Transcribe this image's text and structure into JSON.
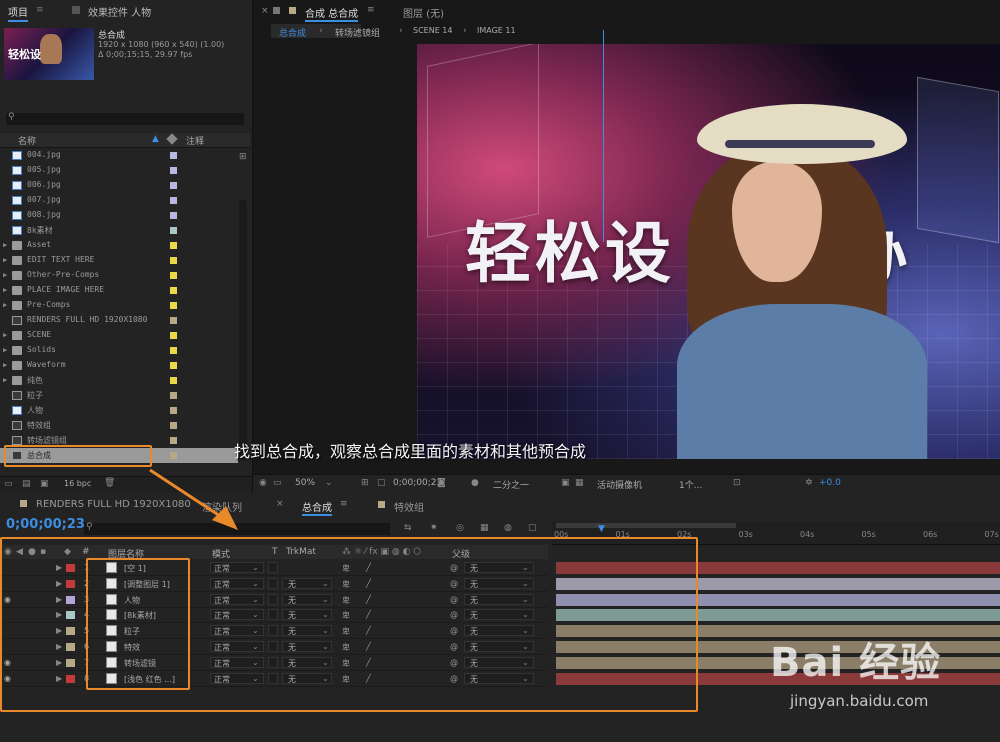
{
  "project_panel": {
    "tabs": [
      "项目",
      "效果控件 人物"
    ],
    "comp_info": {
      "name": "总合成",
      "line1": "1920 x 1080 (960 x 540) (1.00)",
      "line2": "Δ 0;00;15;15, 29.97 fps"
    },
    "thumb_text": "轻松设",
    "columns": {
      "name": "名称",
      "comment": "注释"
    },
    "items": [
      {
        "name": "004.jpg",
        "kind": "file",
        "color": "#b7b7e0"
      },
      {
        "name": "005.jpg",
        "kind": "file",
        "color": "#b7b7e0"
      },
      {
        "name": "006.jpg",
        "kind": "file",
        "color": "#b7b7e0"
      },
      {
        "name": "007.jpg",
        "kind": "file",
        "color": "#b7b7e0"
      },
      {
        "name": "008.jpg",
        "kind": "file",
        "color": "#b7b7e0"
      },
      {
        "name": "8k素材",
        "kind": "file",
        "color": "#a8c8c8"
      },
      {
        "name": "Asset",
        "kind": "folder",
        "color": "#e8d84a"
      },
      {
        "name": "EDIT TEXT HERE",
        "kind": "folder",
        "color": "#e8d84a"
      },
      {
        "name": "Other-Pre-Comps",
        "kind": "folder",
        "color": "#e8d84a"
      },
      {
        "name": "PLACE IMAGE HERE",
        "kind": "folder",
        "color": "#e8d84a"
      },
      {
        "name": "Pre-Comps",
        "kind": "folder",
        "color": "#e8d84a"
      },
      {
        "name": "RENDERS FULL HD 1920X1080",
        "kind": "comp",
        "color": "#b8a888"
      },
      {
        "name": "SCENE",
        "kind": "folder",
        "color": "#e8d84a"
      },
      {
        "name": "Solids",
        "kind": "folder",
        "color": "#e8d84a"
      },
      {
        "name": "Waveform",
        "kind": "folder",
        "color": "#e8d84a"
      },
      {
        "name": "纯色",
        "kind": "folder",
        "color": "#e8d84a"
      },
      {
        "name": "粒子",
        "kind": "comp",
        "color": "#b8a888"
      },
      {
        "name": "人物",
        "kind": "file",
        "color": "#b8a888"
      },
      {
        "name": "特效组",
        "kind": "comp",
        "color": "#b8a888"
      },
      {
        "name": "转场滤镜组",
        "kind": "comp",
        "color": "#b8a888"
      },
      {
        "name": "总合成",
        "kind": "comp",
        "color": "#b8a888",
        "selected": true
      }
    ],
    "bpc": "16 bpc"
  },
  "viewer": {
    "tabs": [
      "合成 总合成",
      "图层 (无)"
    ],
    "breadcrumbs": [
      "总合成",
      "转场滤镜组",
      "SCENE 14",
      "IMAGE 11"
    ],
    "frame_text": "轻松设   高效办",
    "bottom": {
      "zoom": "50%",
      "timecode": "0;00;00;23",
      "resolution": "二分之一",
      "camera": "活动摄像机",
      "views": "1个...",
      "exposure": "+0.0"
    }
  },
  "annotation": "找到总合成，观察总合成里面的素材和其他预合成",
  "timeline": {
    "tabs": [
      "RENDERS FULL HD 1920X1080",
      "渲染队列",
      "总合成",
      "特效组"
    ],
    "timecode": "0;00;00;23",
    "headers": {
      "layer_name": "图层名称",
      "mode": "模式",
      "t": "T",
      "trkmat": "TrkMat",
      "parent": "父级"
    },
    "ruler_labels": [
      "00s",
      "01s",
      "02s",
      "03s",
      "04s",
      "05s",
      "06s",
      "07s"
    ],
    "layers": [
      {
        "num": "1",
        "name": "[空 1]",
        "label_color": "#c23a3a",
        "mode": "正常",
        "trkmat": "",
        "parent": "无",
        "bar_color": "#8a3a3a",
        "visible": false
      },
      {
        "num": "2",
        "name": "[调整图层 1]",
        "label_color": "#c23a3a",
        "mode": "正常",
        "trkmat": "无",
        "parent": "无",
        "bar_color": "#9a9aa8",
        "visible": false
      },
      {
        "num": "3",
        "name": "人物",
        "label_color": "#b5a6d8",
        "mode": "正常",
        "trkmat": "无",
        "parent": "无",
        "bar_color": "#8f8fb0",
        "visible": true
      },
      {
        "num": "4",
        "name": "[8k素材]",
        "label_color": "#a8c8c8",
        "mode": "正常",
        "trkmat": "无",
        "parent": "无",
        "bar_color": "#7e9a94",
        "visible": false
      },
      {
        "num": "5",
        "name": "粒子",
        "label_color": "#b8a888",
        "mode": "正常",
        "trkmat": "无",
        "parent": "无",
        "bar_color": "#8a7e68",
        "visible": false
      },
      {
        "num": "6",
        "name": "特效",
        "label_color": "#b8a888",
        "mode": "正常",
        "trkmat": "无",
        "parent": "无",
        "bar_color": "#8a7e68",
        "visible": false
      },
      {
        "num": "7",
        "name": "转场滤镜",
        "label_color": "#b8a888",
        "mode": "正常",
        "trkmat": "无",
        "parent": "无",
        "bar_color": "#8a7e68",
        "visible": true
      },
      {
        "num": "8",
        "name": "[浅色 红色 ...]",
        "label_color": "#c23a3a",
        "mode": "正常",
        "trkmat": "无",
        "parent": "无",
        "bar_color": "#8a3a3a",
        "visible": true
      }
    ]
  },
  "watermark": {
    "logo": "Bai 经验",
    "url": "jingyan.baidu.com"
  }
}
